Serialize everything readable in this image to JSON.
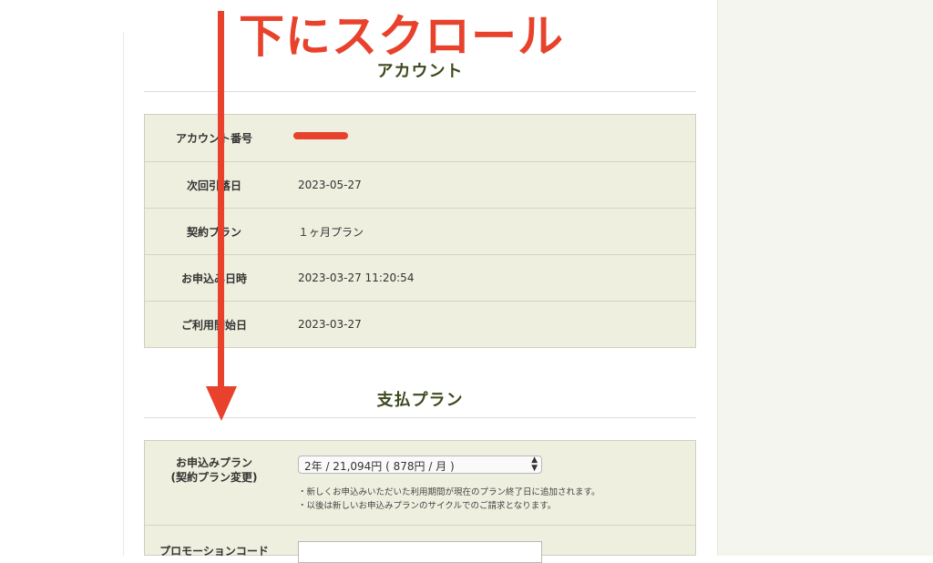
{
  "annotation": {
    "caption": "下にスクロール",
    "color": "#e8412c"
  },
  "account": {
    "title": "アカウント",
    "rows": [
      {
        "label": "アカウント番号",
        "value": ""
      },
      {
        "label": "次回引落日",
        "value": "2023-05-27"
      },
      {
        "label": "契約プラン",
        "value": "１ヶ月プラン"
      },
      {
        "label": "お申込み日時",
        "value": "2023-03-27 11:20:54"
      },
      {
        "label": "ご利用開始日",
        "value": "2023-03-27"
      }
    ]
  },
  "payment": {
    "title": "支払プラン",
    "plan_label_line1": "お申込みプラン",
    "plan_label_line2": "(契約プラン変更)",
    "plan_selected": "2年 / 21,094円 ( 878円 / 月 )",
    "notes": [
      "・新しくお申込みいただいた利用期間が現在のプラン終了日に追加されます。",
      "・以後は新しいお申込みプランのサイクルでのご請求となります。"
    ],
    "promo_label": "プロモーションコード",
    "promo_value": ""
  },
  "colors": {
    "heading": "#3d4a1f",
    "table_bg": "#efefdf",
    "side_panel": "#f5f5ef"
  }
}
